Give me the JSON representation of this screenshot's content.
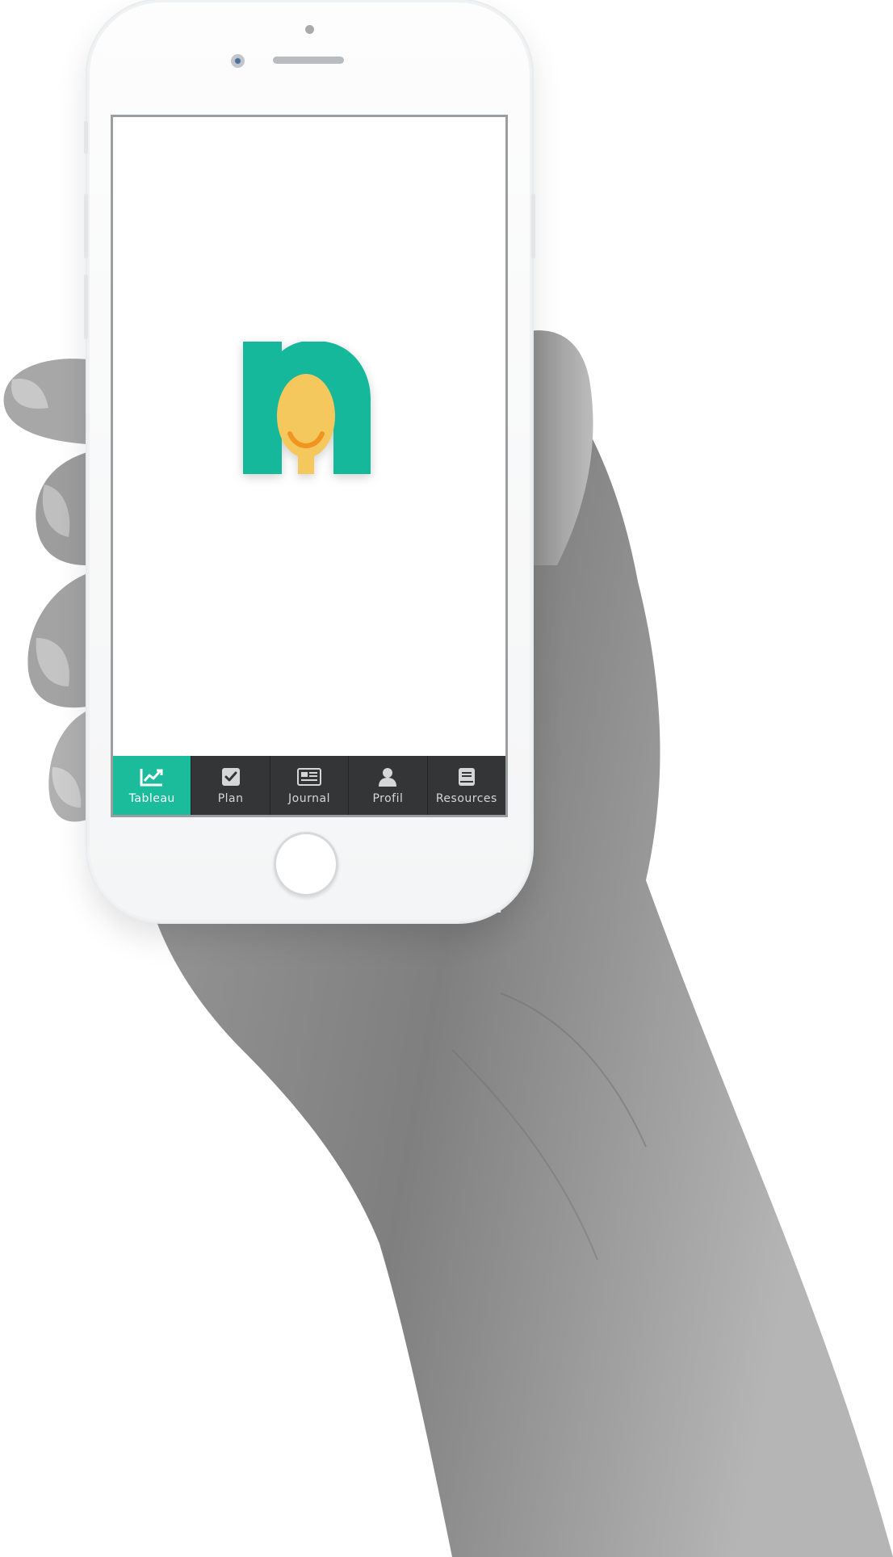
{
  "colors": {
    "accent": "#1abc9c",
    "tabbar_bg": "#333536",
    "tab_text": "#d4d6d7",
    "logo_green": "#16b89b",
    "logo_yellow": "#f5c85d",
    "logo_orange": "#f19420"
  },
  "app": {
    "logo_icon": "nutrition-spoon-logo"
  },
  "tabbar": {
    "active_index": 0,
    "tabs": [
      {
        "label": "Tableau",
        "icon": "chart-line-icon"
      },
      {
        "label": "Plan",
        "icon": "checkbox-icon"
      },
      {
        "label": "Journal",
        "icon": "newspaper-icon"
      },
      {
        "label": "Profil",
        "icon": "user-icon"
      },
      {
        "label": "Resources",
        "icon": "book-icon"
      }
    ]
  }
}
